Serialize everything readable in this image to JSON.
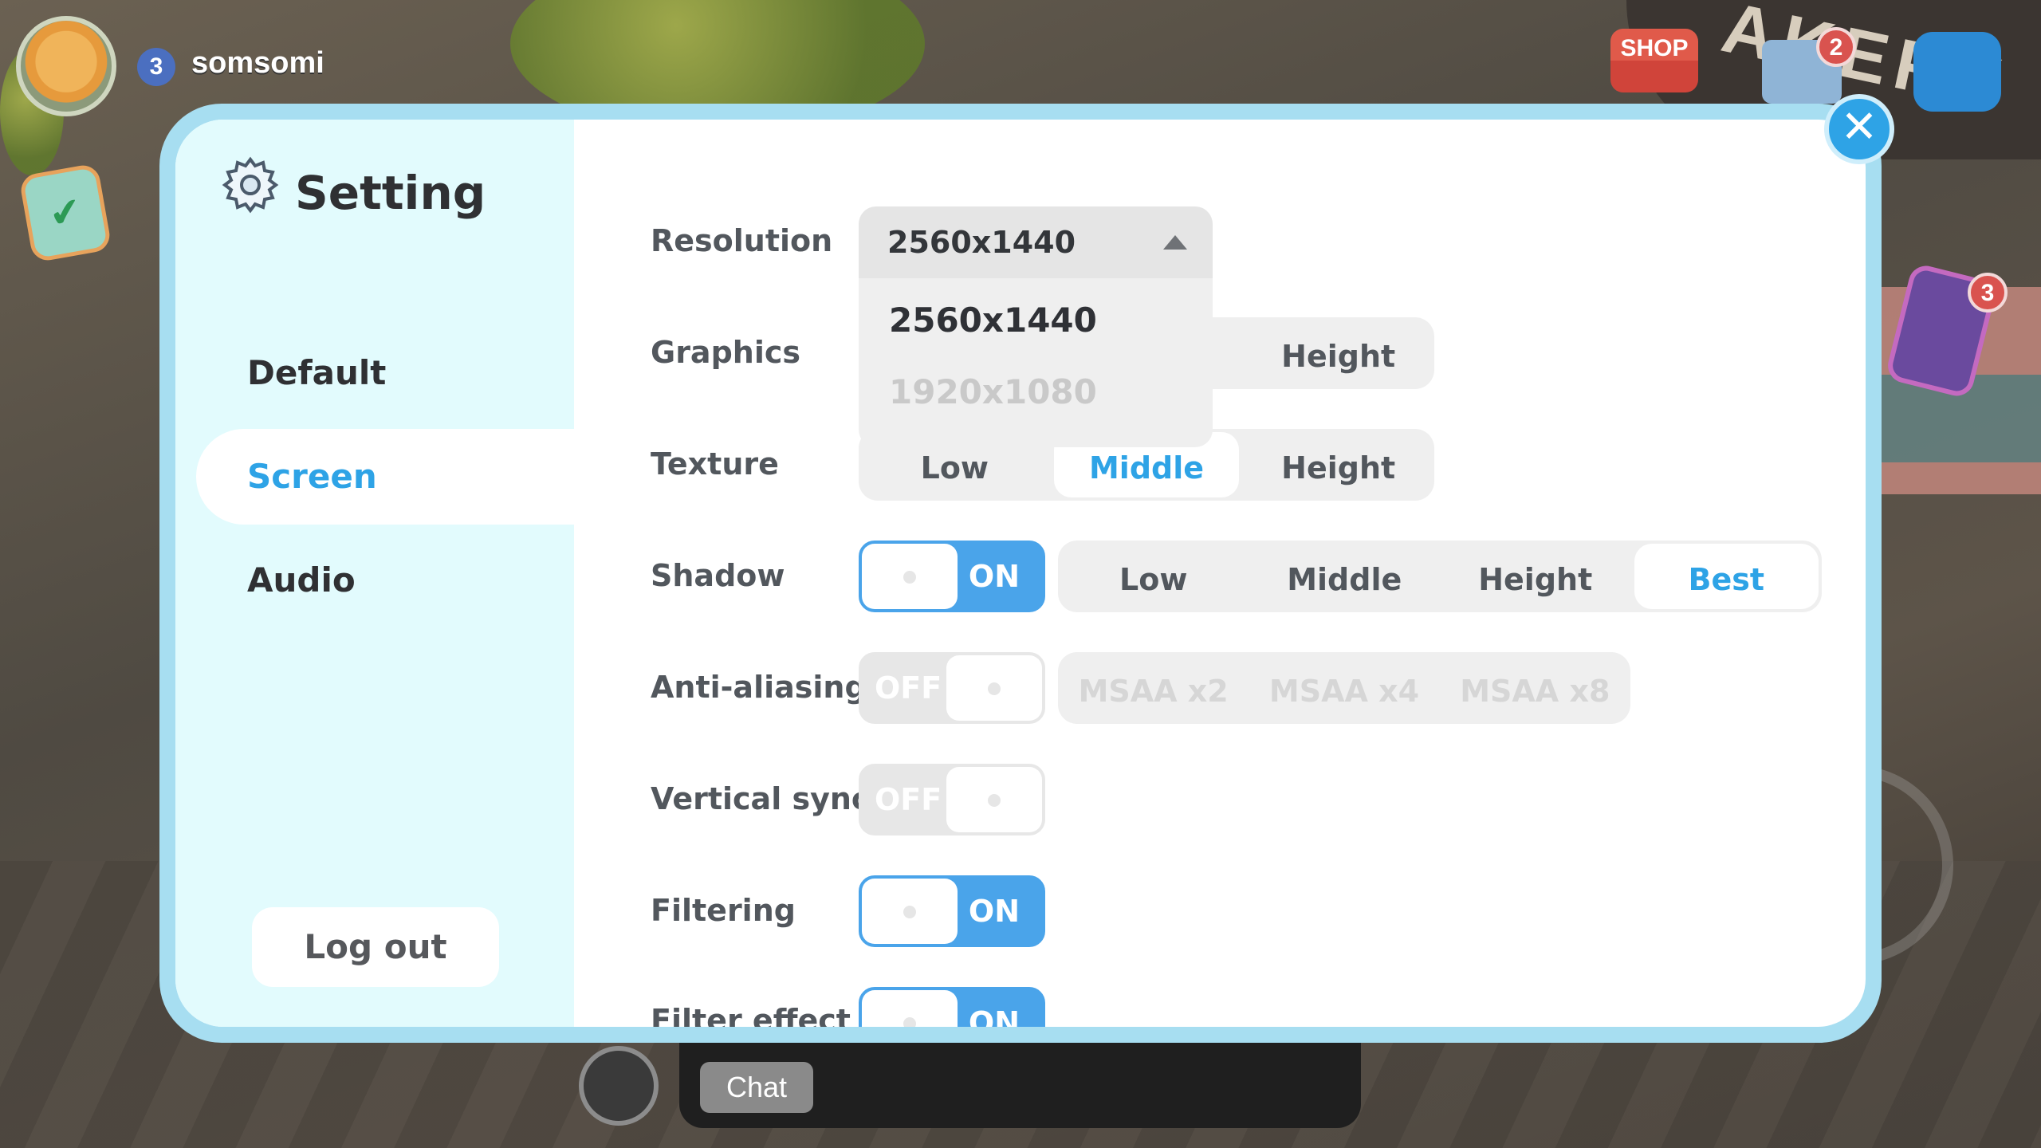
{
  "hud": {
    "level": "3",
    "username": "somsomi",
    "shop_label": "SHOP",
    "mail_badge": "2",
    "phone_badge": "3",
    "chat_label": "Chat",
    "background_sign": "AKERY"
  },
  "dialog": {
    "title": "Setting",
    "close_icon": "close-icon",
    "sidebar": {
      "items": [
        {
          "label": "Default",
          "active": false
        },
        {
          "label": "Screen",
          "active": true
        },
        {
          "label": "Audio",
          "active": false
        }
      ],
      "logout_label": "Log out"
    },
    "settings": {
      "resolution": {
        "label": "Resolution",
        "value": "2560x1440",
        "options": [
          "2560x1440",
          "1920x1080"
        ]
      },
      "graphics": {
        "label": "Graphics",
        "options": [
          "Height"
        ]
      },
      "texture": {
        "label": "Texture",
        "options": [
          "Low",
          "Middle",
          "Height"
        ],
        "selected": "Middle"
      },
      "shadow": {
        "label": "Shadow",
        "toggle": "ON",
        "options": [
          "Low",
          "Middle",
          "Height",
          "Best"
        ],
        "selected": "Best"
      },
      "anti_aliasing": {
        "label": "Anti-aliasing",
        "toggle": "OFF",
        "options": [
          "MSAA x2",
          "MSAA x4",
          "MSAA x8"
        ]
      },
      "vertical_sync": {
        "label": "Vertical sync",
        "toggle": "OFF"
      },
      "filtering": {
        "label": "Filtering",
        "toggle": "ON"
      },
      "filter_effect": {
        "label": "Filter effect",
        "toggle": "ON"
      }
    }
  },
  "colors": {
    "accent": "#2ea3e6",
    "dialog_border": "#a7def1",
    "sidebar_bg": "#e2fbfd",
    "toggle_on": "#4aa4ea"
  }
}
